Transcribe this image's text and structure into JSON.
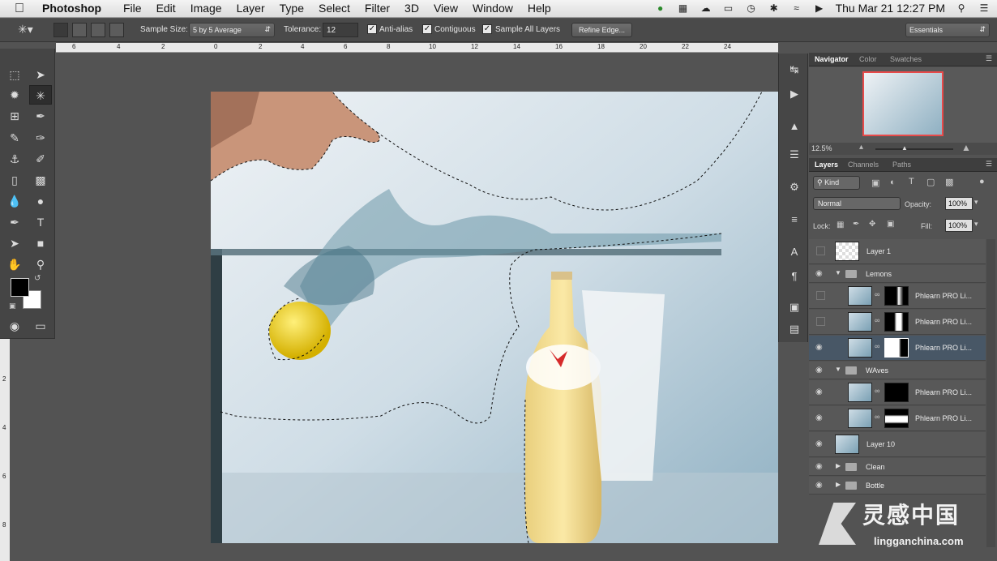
{
  "menubar": {
    "app": "Photoshop",
    "menus": [
      "File",
      "Edit",
      "Image",
      "Layer",
      "Type",
      "Select",
      "Filter",
      "3D",
      "View",
      "Window",
      "Help"
    ],
    "clock": "Thu Mar 21  12:27 PM"
  },
  "options": {
    "sample_size_label": "Sample Size:",
    "sample_size_value": "5 by 5 Average",
    "tolerance_label": "Tolerance:",
    "tolerance_value": "12",
    "anti_alias": "Anti-alias",
    "contiguous": "Contiguous",
    "sample_all": "Sample All Layers",
    "refine_edge": "Refine Edge...",
    "workspace": "Essentials"
  },
  "ruler_top": [
    "6",
    "4",
    "2",
    "0",
    "2",
    "4",
    "6",
    "8",
    "10",
    "12",
    "14",
    "16",
    "18",
    "20",
    "22",
    "24"
  ],
  "ruler_left": [
    "2",
    "4",
    "6",
    "8"
  ],
  "navigator": {
    "tabs": [
      "Navigator",
      "Color",
      "Swatches"
    ],
    "zoom": "12.5%"
  },
  "layers_panel": {
    "tabs": [
      "Layers",
      "Channels",
      "Paths"
    ],
    "kind": "Kind",
    "blend_mode": "Normal",
    "opacity_label": "Opacity:",
    "opacity": "100%",
    "lock_label": "Lock:",
    "fill_label": "Fill:",
    "fill": "100%",
    "layers": [
      {
        "name": "Layer 1",
        "visible": false,
        "type": "layer"
      },
      {
        "name": "Lemons",
        "visible": true,
        "type": "group-open"
      },
      {
        "name": "Phlearn PRO Li...",
        "visible": false,
        "type": "masked"
      },
      {
        "name": "Phlearn PRO Li...",
        "visible": false,
        "type": "masked"
      },
      {
        "name": "Phlearn PRO Li...",
        "visible": true,
        "type": "masked",
        "selected": true
      },
      {
        "name": "WAves",
        "visible": true,
        "type": "group-open"
      },
      {
        "name": "Phlearn PRO Li...",
        "visible": true,
        "type": "masked"
      },
      {
        "name": "Phlearn PRO Li...",
        "visible": true,
        "type": "masked"
      },
      {
        "name": "Layer 10",
        "visible": true,
        "type": "layer"
      },
      {
        "name": "Clean",
        "visible": true,
        "type": "group-closed"
      },
      {
        "name": "Bottle",
        "visible": true,
        "type": "group-closed"
      }
    ]
  },
  "watermark": {
    "cn": "灵感中国",
    "url": "lingganchina.com"
  }
}
